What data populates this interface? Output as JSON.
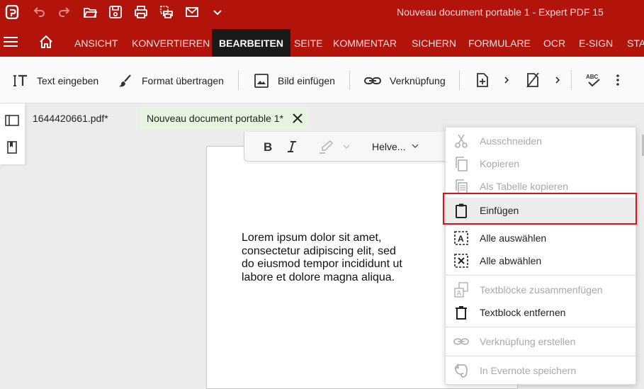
{
  "window": {
    "title": "Nouveau document portable 1   -   Expert PDF 15"
  },
  "ribbon": {
    "tabs": [
      {
        "label": "ANSICHT"
      },
      {
        "label": "KONVERTIEREN"
      },
      {
        "label": "BEARBEITEN"
      },
      {
        "label": "SEITE"
      },
      {
        "label": "KOMMENTAR"
      },
      {
        "label": "SICHERN"
      },
      {
        "label": "FORMULARE"
      },
      {
        "label": "OCR"
      },
      {
        "label": "E-SIGN"
      },
      {
        "label": "STA"
      }
    ],
    "active_tab": "BEARBEITEN"
  },
  "toolbar": {
    "text_input": "Text eingeben",
    "format_copy": "Format übertragen",
    "insert_image": "Bild einfügen",
    "link": "Verknüpfung"
  },
  "doc_tabs": [
    {
      "label": "1644420661.pdf*"
    },
    {
      "label": "Nouveau document portable 1*"
    }
  ],
  "format_bar": {
    "font": "Helve..."
  },
  "page": {
    "lines": [
      "Lorem ipsum dolor sit amet,",
      "consectetur adipiscing elit, sed",
      "do eiusmod tempor incididunt ut",
      "labore et dolore magna aliqua."
    ]
  },
  "context_menu": {
    "items": [
      {
        "label": "Ausschneiden",
        "icon": "scissors-icon",
        "enabled": false
      },
      {
        "label": "Kopieren",
        "icon": "copy-icon",
        "enabled": false
      },
      {
        "label": "Als Tabelle kopieren",
        "icon": "copy-table-icon",
        "enabled": false
      },
      {
        "label": "Einfügen",
        "icon": "clipboard-icon",
        "enabled": true,
        "highlighted": true
      },
      {
        "label": "Alle auswählen",
        "icon": "select-all-icon",
        "enabled": true
      },
      {
        "label": "Alle abwählen",
        "icon": "deselect-all-icon",
        "enabled": true
      },
      {
        "label": "Textblöcke zusammenfügen",
        "icon": "merge-text-icon",
        "enabled": false
      },
      {
        "label": "Textblock entfernen",
        "icon": "trash-icon",
        "enabled": true
      },
      {
        "label": "Verknüpfung erstellen",
        "icon": "link-icon",
        "enabled": false
      },
      {
        "label": "In Evernote speichern",
        "icon": "evernote-icon",
        "enabled": false
      }
    ]
  },
  "colors": {
    "brand_red": "#b2140c",
    "active_tab_bg": "#1a1a1a",
    "active_doc_tab_bg": "#e6f5e0",
    "highlight_border": "#e0101a"
  }
}
